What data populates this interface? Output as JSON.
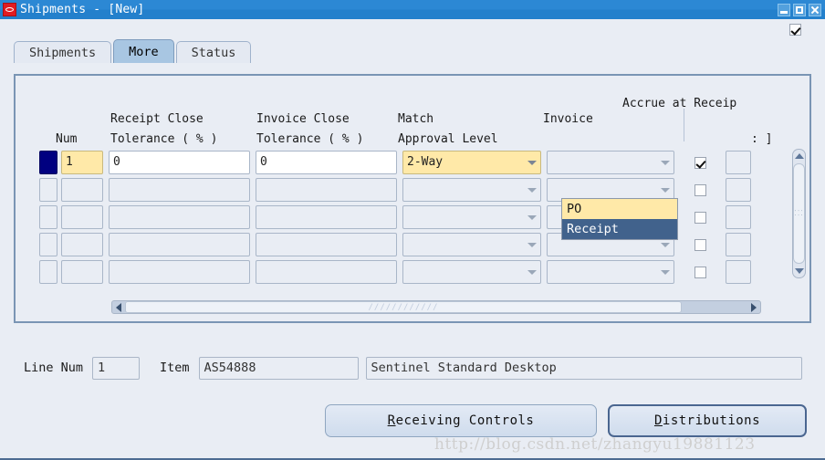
{
  "window": {
    "title": "Shipments - [New]",
    "icon": "oracle-icon",
    "buttons": {
      "minimize": "minimize-icon",
      "maximize": "maximize-icon",
      "close": "close-icon"
    }
  },
  "topstrip": {
    "checkbox_checked": true
  },
  "tabs": [
    {
      "label": "Shipments",
      "active": false
    },
    {
      "label": "More",
      "active": true
    },
    {
      "label": "Status",
      "active": false
    }
  ],
  "grid": {
    "headers": {
      "num": "Num",
      "receipt_close_line1": "Receipt Close",
      "receipt_close_line2": "Tolerance ( % )",
      "invoice_close_line1": "Invoice Close",
      "invoice_close_line2": "Tolerance ( % )",
      "match_line1": "Match",
      "match_line2": "Approval Level",
      "invoice": "Invoice",
      "accrue": "Accrue at Receip",
      "far_right": ": ]"
    },
    "rows": [
      {
        "selected": true,
        "num": "1",
        "receipt_close_tolerance": "0",
        "invoice_close_tolerance": "0",
        "match_approval_level": "2-Way",
        "invoice_match_option": "Receipt",
        "accrue_at_receipt": true,
        "far_right": ""
      },
      {
        "selected": false,
        "num": "",
        "receipt_close_tolerance": "",
        "invoice_close_tolerance": "",
        "match_approval_level": "",
        "invoice_match_option": "",
        "accrue_at_receipt": false,
        "far_right": ""
      },
      {
        "selected": false,
        "num": "",
        "receipt_close_tolerance": "",
        "invoice_close_tolerance": "",
        "match_approval_level": "",
        "invoice_match_option": "",
        "accrue_at_receipt": false,
        "far_right": ""
      },
      {
        "selected": false,
        "num": "",
        "receipt_close_tolerance": "",
        "invoice_close_tolerance": "",
        "match_approval_level": "",
        "invoice_match_option": "",
        "accrue_at_receipt": false,
        "far_right": ""
      },
      {
        "selected": false,
        "num": "",
        "receipt_close_tolerance": "",
        "invoice_close_tolerance": "",
        "match_approval_level": "",
        "invoice_match_option": "",
        "accrue_at_receipt": false,
        "far_right": ""
      }
    ]
  },
  "dropdown": {
    "open": true,
    "options": [
      {
        "label": "PO",
        "state": "current"
      },
      {
        "label": "Receipt",
        "state": "highlighted"
      }
    ]
  },
  "bottom": {
    "line_num_label": "Line Num",
    "line_num_value": "1",
    "item_label": "Item",
    "item_value": "AS54888",
    "description_value": "Sentinel Standard Desktop"
  },
  "buttons": {
    "receiving_controls": {
      "mnemonic": "R",
      "rest": "eceiving Controls"
    },
    "distributions": {
      "mnemonic": "D",
      "rest": "istributions"
    }
  },
  "watermark": "http://blog.csdn.net/zhangyu19881123",
  "colors": {
    "titlebar": "#2c88d4",
    "background": "#e9edf4",
    "selected_row": "#000080",
    "active_field": "#ffe9a8",
    "highlight": "#41628c",
    "tab_active": "#a8c6e2"
  }
}
